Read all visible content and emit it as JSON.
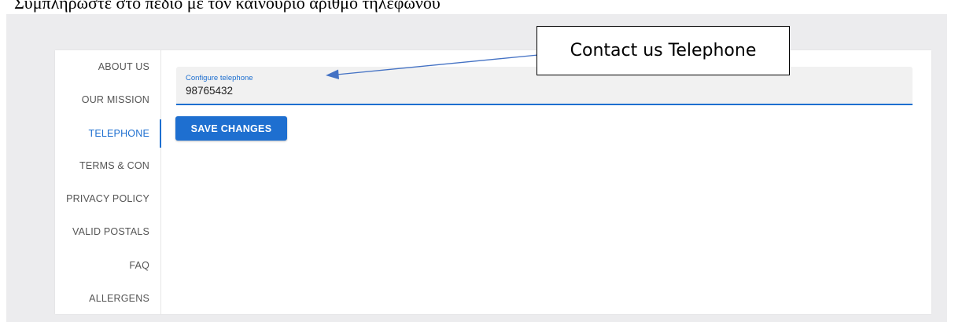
{
  "caption": "Συμπληρώστε στο πεδίο με τον καινούριο αριθμό τηλεφώνου",
  "sidebar": {
    "items": [
      {
        "label": "ABOUT US",
        "active": false
      },
      {
        "label": "OUR MISSION",
        "active": false
      },
      {
        "label": "TELEPHONE",
        "active": true
      },
      {
        "label": "TERMS & CON",
        "active": false
      },
      {
        "label": "PRIVACY POLICY",
        "active": false
      },
      {
        "label": "VALID POSTALS",
        "active": false
      },
      {
        "label": "FAQ",
        "active": false
      },
      {
        "label": "ALLERGENS",
        "active": false
      }
    ]
  },
  "form": {
    "field_label": "Configure telephone",
    "field_value": "98765432",
    "save_label": "SAVE CHANGES"
  },
  "annotation": {
    "text": "Contact us Telephone",
    "arrow_icon": "arrow-left-icon"
  },
  "colors": {
    "accent": "#1e6fd0",
    "background": "#ececee",
    "panel": "#ffffff"
  }
}
